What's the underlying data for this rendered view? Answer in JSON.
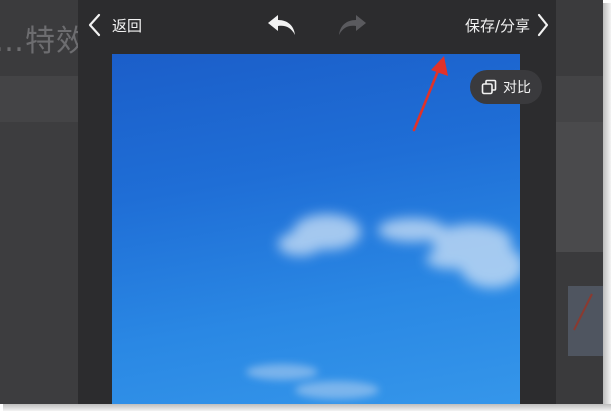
{
  "backdrop": {
    "title_fragment": "…特效…"
  },
  "topbar": {
    "back_label": "返回",
    "save_share_label": "保存/分享"
  },
  "tools": {
    "compare_label": "对比"
  },
  "icons": {
    "back": "chevron-left-icon",
    "undo": "undo-arrow-icon",
    "redo": "redo-arrow-icon",
    "save": "chevron-right-icon",
    "compare": "compare-squares-icon"
  },
  "colors": {
    "panel_bg": "#2c2c2e",
    "annotation_arrow": "#e0322a",
    "sky_top": "#1b5ec9",
    "sky_bottom": "#3596ea"
  }
}
